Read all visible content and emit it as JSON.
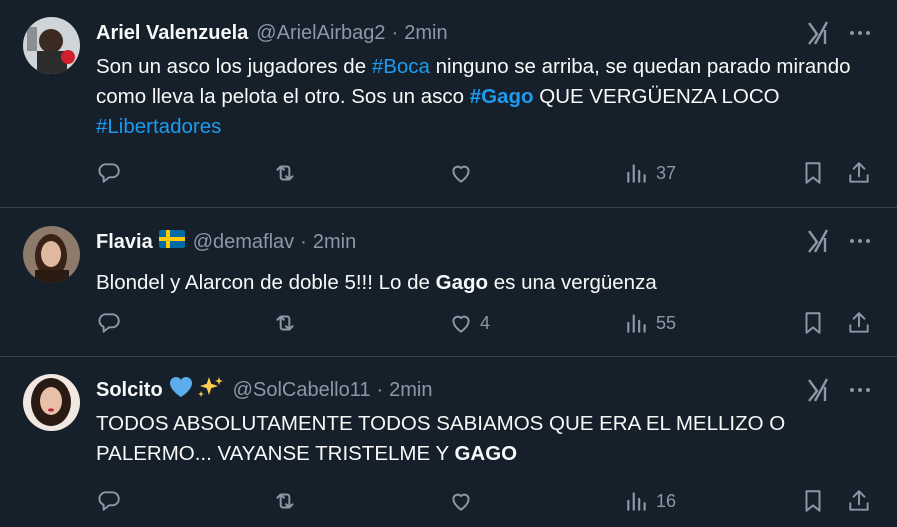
{
  "tweets": [
    {
      "name": "Ariel Valenzuela",
      "handle": "@ArielAirbag2",
      "separator": "·",
      "time": "2min",
      "text_segments": [
        {
          "text": "Son un asco los jugadores de ",
          "style": "plain"
        },
        {
          "text": "#Boca",
          "style": "hashtag"
        },
        {
          "text": " ninguno se arriba, se quedan parado mirando como lleva la pelota el otro. Sos un asco ",
          "style": "plain"
        },
        {
          "text": "#Gago",
          "style": "hashtag-bold"
        },
        {
          "text": " QUE VERGÜENZA LOCO ",
          "style": "plain"
        },
        {
          "text": "#Libertadores",
          "style": "hashtag"
        }
      ],
      "reply_count": "",
      "retweet_count": "",
      "like_count": "",
      "views_count": "37"
    },
    {
      "name": "Flavia",
      "name_emoji": "🇸🇪",
      "handle": "@demaflav",
      "separator": "·",
      "time": "2min",
      "text_segments": [
        {
          "text": "Blondel y Alarcon de doble 5!!! Lo de ",
          "style": "plain"
        },
        {
          "text": "Gago",
          "style": "bold"
        },
        {
          "text": " es una vergüenza",
          "style": "plain"
        }
      ],
      "reply_count": "",
      "retweet_count": "",
      "like_count": "4",
      "views_count": "55"
    },
    {
      "name": "Solcito",
      "name_emoji": "💙✨",
      "handle": "@SolCabello11",
      "separator": "·",
      "time": "2min",
      "text_segments": [
        {
          "text": "TODOS ABSOLUTAMENTE TODOS SABIAMOS QUE ERA EL MELLIZO O PALERMO... VAYANSE TRISTELME Y ",
          "style": "plain"
        },
        {
          "text": "GAGO",
          "style": "bold"
        }
      ],
      "reply_count": "",
      "retweet_count": "",
      "like_count": "",
      "views_count": "16"
    }
  ],
  "colors": {
    "background": "#15202b",
    "divider": "#38444d",
    "text_primary": "#f7f9f9",
    "text_secondary": "#8b98a5",
    "link": "#1d9bf0"
  },
  "icons": {
    "top_right": [
      "grok-icon",
      "more-icon"
    ],
    "actions": [
      "reply-icon",
      "retweet-icon",
      "like-icon",
      "views-icon",
      "bookmark-icon",
      "share-icon"
    ]
  }
}
